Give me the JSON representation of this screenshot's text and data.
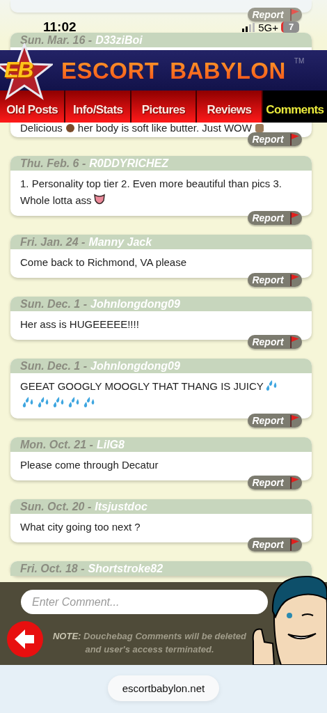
{
  "status_bar": {
    "time": "11:02",
    "network": "5G+",
    "battery": "7"
  },
  "banner": {
    "logo": "EB",
    "title": "ESCORT BABYLON",
    "trademark": "TM"
  },
  "tabs": [
    {
      "label": "Old Posts",
      "selected": false
    },
    {
      "label": "Info/Stats",
      "selected": false
    },
    {
      "label": "Pictures",
      "selected": false
    },
    {
      "label": "Reviews",
      "selected": false
    },
    {
      "label": "Comments",
      "selected": true
    }
  ],
  "top_card": {
    "report": "Report"
  },
  "comments": [
    {
      "date": "Sun. Mar. 16 -",
      "user": "D33ziBoi",
      "report": "Report",
      "body": [
        {
          "kind": "text",
          "text": "Delicious"
        },
        {
          "kind": "dot"
        },
        {
          "kind": "text",
          "text": "her body is soft like butter. Just WOW"
        },
        {
          "kind": "face"
        }
      ]
    },
    {
      "date": "Thu. Feb. 6 -",
      "user": "R0DDYRICHEZ",
      "report": "Report",
      "body": [
        {
          "kind": "text",
          "text": "1. Personality top tier 2. Even more beautiful than pics 3."
        },
        {
          "kind": "break"
        },
        {
          "kind": "text",
          "text": "Whole lotta ass"
        },
        {
          "kind": "tongue"
        }
      ]
    },
    {
      "date": "Fri. Jan. 24 -",
      "user": "Manny Jack",
      "report": "Report",
      "body": [
        {
          "kind": "text",
          "text": "Come back to Richmond, VA please"
        }
      ]
    },
    {
      "date": "Sun. Dec. 1 -",
      "user": "Johnlongdong09",
      "report": "Report",
      "body": [
        {
          "kind": "text",
          "text": "Her ass is HUGEEEEE!!!!"
        }
      ]
    },
    {
      "date": "Sun. Dec. 1 -",
      "user": "Johnlongdong09",
      "report": "Report",
      "body": [
        {
          "kind": "text",
          "text": "GEEAT GOOGLY MOOGLY THAT THANG IS JUICY"
        },
        {
          "kind": "droplets"
        },
        {
          "kind": "break"
        },
        {
          "kind": "droplets"
        },
        {
          "kind": "droplets"
        },
        {
          "kind": "droplets"
        },
        {
          "kind": "droplets"
        },
        {
          "kind": "droplets"
        }
      ]
    },
    {
      "date": "Mon. Oct. 21 -",
      "user": "LilG8",
      "report": "Report",
      "body": [
        {
          "kind": "text",
          "text": "Please come through Decatur"
        }
      ]
    },
    {
      "date": "Sun. Oct. 20 -",
      "user": "Itsjustdoc",
      "report": "Report",
      "body": [
        {
          "kind": "text",
          "text": "What city going too next ?"
        }
      ]
    },
    {
      "date": "Fri. Oct. 18 -",
      "user": "Shortstroke82"
    }
  ],
  "comment_form": {
    "placeholder": "Enter Comment...",
    "note": "**NOTE:** Douchebag Comments will be deleted and user's access terminated."
  },
  "browser": {
    "url": "escortbabylon.net"
  }
}
